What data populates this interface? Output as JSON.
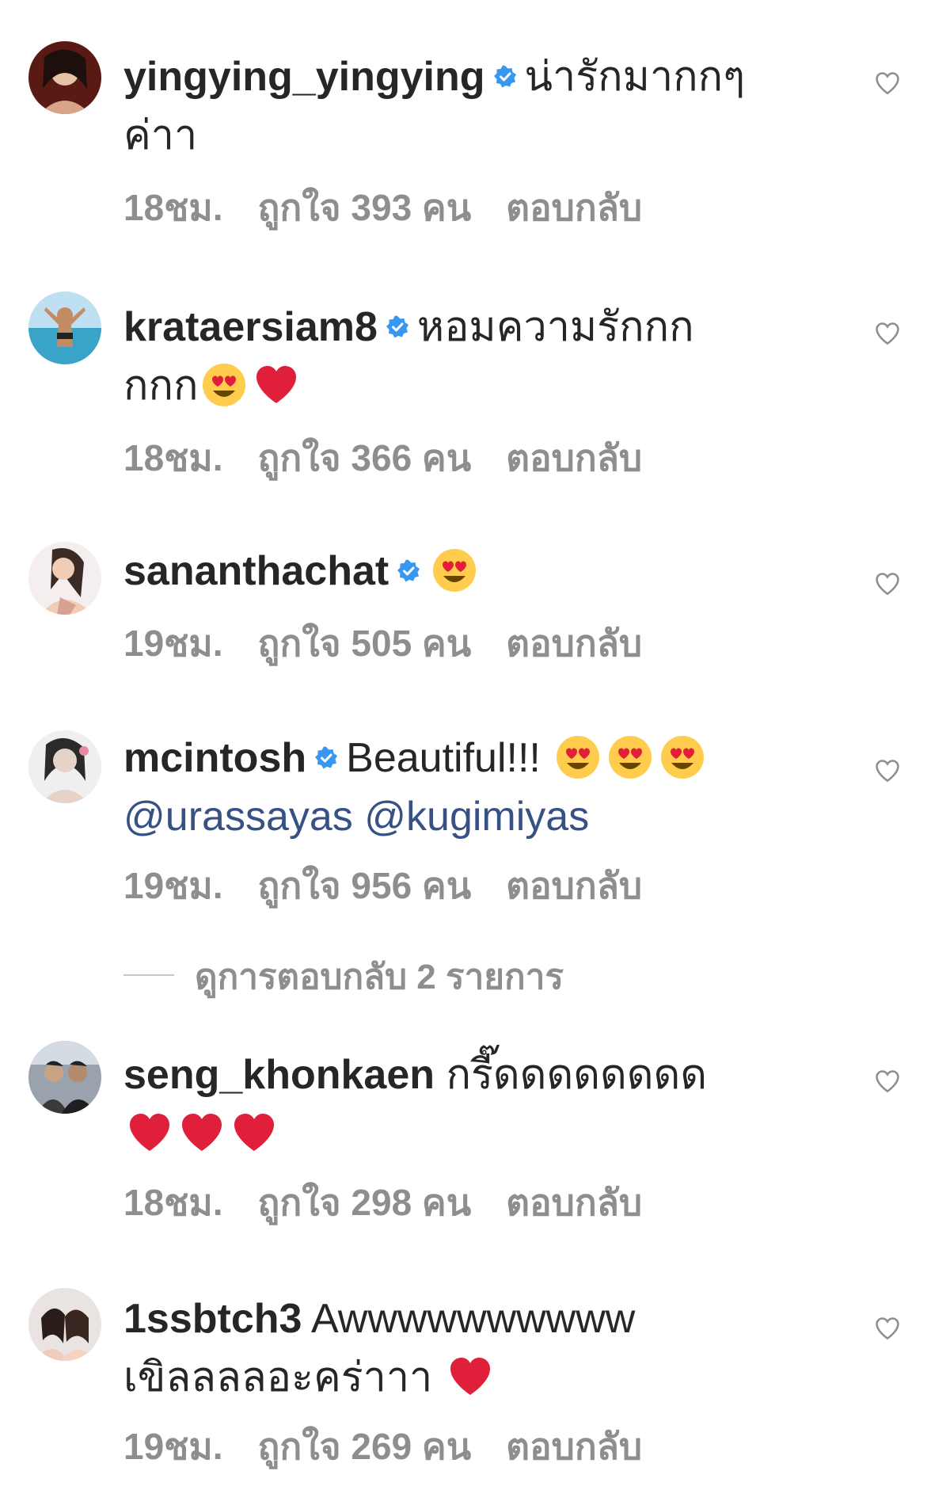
{
  "comments": [
    {
      "username": "yingying_yingying",
      "verified": true,
      "text_line1": "น่ารักมากกๆ",
      "text_line2": "ค่าา",
      "time": "18ชม.",
      "likes": "ถูกใจ 393 คน",
      "reply": "ตอบกลับ"
    },
    {
      "username": "krataersiam8",
      "verified": true,
      "text_line1": "หอมความรักกก",
      "text_line2": "กกก",
      "time": "18ชม.",
      "likes": "ถูกใจ 366 คน",
      "reply": "ตอบกลับ"
    },
    {
      "username": "sananthachat",
      "verified": true,
      "time": "19ชม.",
      "likes": "ถูกใจ 505 คน",
      "reply": "ตอบกลับ"
    },
    {
      "username": "mcintosh",
      "verified": true,
      "text_line1": "Beautiful!!!",
      "mention1": "@urassayas",
      "mention2": "@kugimiyas",
      "time": "19ชม.",
      "likes": "ถูกใจ 956 คน",
      "reply": "ตอบกลับ"
    },
    {
      "username": "seng_khonkaen",
      "verified": false,
      "text_line1": "กรี๊ดดดดดดดด",
      "time": "18ชม.",
      "likes": "ถูกใจ 298 คน",
      "reply": "ตอบกลับ"
    },
    {
      "username": "1ssbtch3",
      "verified": false,
      "text_line1": "Awwwwwwwwww",
      "text_line2": "เขิลลลลอะคร่าาา",
      "time": "19ชม.",
      "likes": "ถูกใจ 269 คน",
      "reply": "ตอบกลับ"
    }
  ],
  "view_replies": "ดูการตอบกลับ 2 รายการ",
  "icons": {
    "verified": "verified-badge-icon",
    "like": "heart-outline-icon",
    "heart_eyes": "heart-eyes-emoji",
    "red_heart": "red-heart-emoji"
  },
  "colors": {
    "verified": "#3897f0",
    "mention": "#385185",
    "meta": "#8e8e8e",
    "heart": "#e0203a"
  }
}
